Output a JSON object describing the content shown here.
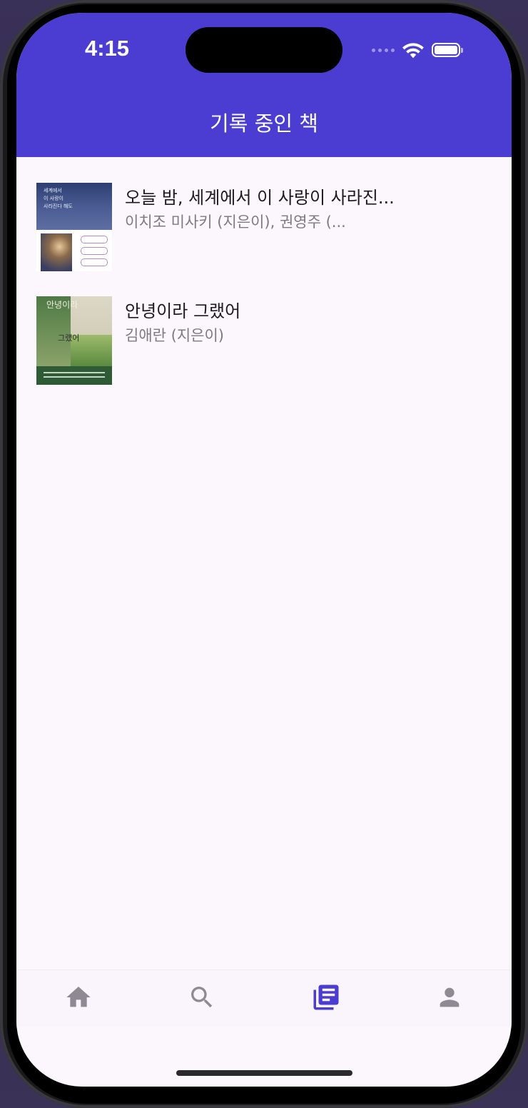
{
  "status_bar": {
    "time": "4:15"
  },
  "header": {
    "title": "기록 중인 책"
  },
  "books": [
    {
      "title": "오늘 밤, 세계에서 이 사랑이 사라진...",
      "author": "이치조 미사키 (지은이), 권영주 (...",
      "cover": {
        "lines": [
          "세계에서",
          "이 사랑이",
          "사라진다 해도"
        ]
      }
    },
    {
      "title": "안녕이라 그랬어",
      "author": "김애란 (지은이)",
      "cover": {
        "lines": [
          "안녕이라",
          "그랬어"
        ]
      }
    }
  ],
  "bottom_nav": {
    "items": [
      {
        "icon": "home-icon",
        "active": false
      },
      {
        "icon": "search-icon",
        "active": false
      },
      {
        "icon": "library-books-icon",
        "active": true
      },
      {
        "icon": "person-icon",
        "active": false
      }
    ],
    "active_color": "#4b3dd2",
    "inactive_color": "#8e8a94"
  },
  "colors": {
    "header": "#4b3dd2",
    "background": "#fbf7fd"
  }
}
